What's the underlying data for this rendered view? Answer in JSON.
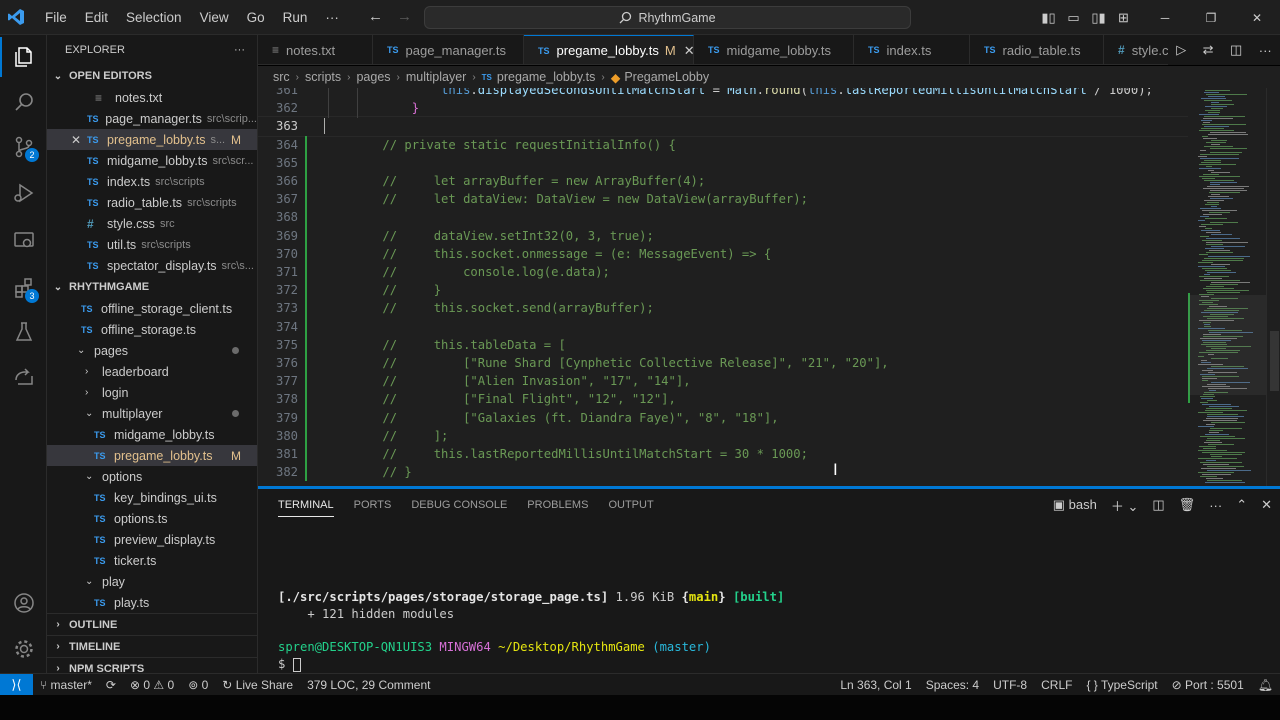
{
  "titlebar": {
    "menu": [
      "File",
      "Edit",
      "Selection",
      "View",
      "Go",
      "Run",
      "···"
    ],
    "search": "RhythmGame"
  },
  "activity": {
    "scm_badge": "2",
    "ext_badge": "3"
  },
  "sidebar": {
    "title": "EXPLORER",
    "open_editors_title": "OPEN EDITORS",
    "open_editors": [
      {
        "icon": "txt",
        "name": "notes.txt",
        "path": ""
      },
      {
        "icon": "TS",
        "name": "page_manager.ts",
        "path": "src\\scrip..."
      },
      {
        "icon": "TS",
        "name": "pregame_lobby.ts",
        "path": "s...",
        "status": "M"
      },
      {
        "icon": "TS",
        "name": "midgame_lobby.ts",
        "path": "src\\scr..."
      },
      {
        "icon": "TS",
        "name": "index.ts",
        "path": "src\\scripts"
      },
      {
        "icon": "TS",
        "name": "radio_table.ts",
        "path": "src\\scripts"
      },
      {
        "icon": "#",
        "name": "style.css",
        "path": "src"
      },
      {
        "icon": "TS",
        "name": "util.ts",
        "path": "src\\scripts"
      },
      {
        "icon": "TS",
        "name": "spectator_display.ts",
        "path": "src\\s..."
      }
    ],
    "project_title": "RHYTHMGAME",
    "tree": [
      {
        "icon": "TS",
        "name": "offline_storage_client.ts"
      },
      {
        "icon": "TS",
        "name": "offline_storage.ts"
      },
      {
        "folder": true,
        "open": true,
        "name": "pages"
      },
      {
        "folder": true,
        "open": false,
        "name": "leaderboard"
      },
      {
        "folder": true,
        "open": false,
        "name": "login"
      },
      {
        "folder": true,
        "open": true,
        "name": "multiplayer"
      },
      {
        "icon": "TS",
        "name": "midgame_lobby.ts"
      },
      {
        "icon": "TS",
        "name": "pregame_lobby.ts",
        "status": "M"
      },
      {
        "folder": true,
        "open": true,
        "name": "options"
      },
      {
        "icon": "TS",
        "name": "key_bindings_ui.ts"
      },
      {
        "icon": "TS",
        "name": "options.ts"
      },
      {
        "icon": "TS",
        "name": "preview_display.ts"
      },
      {
        "icon": "TS",
        "name": "ticker.ts"
      },
      {
        "folder": true,
        "open": true,
        "name": "play"
      },
      {
        "icon": "TS",
        "name": "play.ts"
      }
    ],
    "outline": "OUTLINE",
    "timeline": "TIMELINE",
    "npm": "NPM SCRIPTS"
  },
  "tabs": [
    {
      "icon": "txt",
      "name": "notes.txt"
    },
    {
      "icon": "TS",
      "name": "page_manager.ts"
    },
    {
      "icon": "TS",
      "name": "pregame_lobby.ts",
      "status": "M",
      "active": true
    },
    {
      "icon": "TS",
      "name": "midgame_lobby.ts"
    },
    {
      "icon": "TS",
      "name": "index.ts"
    },
    {
      "icon": "TS",
      "name": "radio_table.ts"
    },
    {
      "icon": "#",
      "name": "style.cs"
    }
  ],
  "breadcrumb": {
    "parts": [
      "src",
      "scripts",
      "pages",
      "multiplayer"
    ],
    "file": "pregame_lobby.ts",
    "symbol": "PregameLobby"
  },
  "editor": {
    "lines": [
      {
        "n": "361",
        "text": "            this.displayedSecondsUntilMatchStart = Math.round(this.lastReportedMillisUntilMatchStart / 1000);"
      },
      {
        "n": "362",
        "text": "        }"
      },
      {
        "n": "363",
        "text": ""
      },
      {
        "n": "364",
        "text": "    // private static requestInitialInfo() {"
      },
      {
        "n": "365",
        "text": ""
      },
      {
        "n": "366",
        "text": "    //     let arrayBuffer = new ArrayBuffer(4);"
      },
      {
        "n": "367",
        "text": "    //     let dataView: DataView = new DataView(arrayBuffer);"
      },
      {
        "n": "368",
        "text": ""
      },
      {
        "n": "369",
        "text": "    //     dataView.setInt32(0, 3, true);"
      },
      {
        "n": "370",
        "text": "    //     this.socket.onmessage = (e: MessageEvent) => {"
      },
      {
        "n": "371",
        "text": "    //         console.log(e.data);"
      },
      {
        "n": "372",
        "text": "    //     }"
      },
      {
        "n": "373",
        "text": "    //     this.socket.send(arrayBuffer);"
      },
      {
        "n": "374",
        "text": ""
      },
      {
        "n": "375",
        "text": "    //     this.tableData = ["
      },
      {
        "n": "376",
        "text": "    //         [\"Rune Shard [Cynphetic Collective Release]\", \"21\", \"20\"],"
      },
      {
        "n": "377",
        "text": "    //         [\"Alien Invasion\", \"17\", \"14\"],"
      },
      {
        "n": "378",
        "text": "    //         [\"Final Flight\", \"12\", \"12\"],"
      },
      {
        "n": "379",
        "text": "    //         [\"Galaxies (ft. Diandra Faye)\", \"8\", \"18\"],"
      },
      {
        "n": "380",
        "text": "    //     ];"
      },
      {
        "n": "381",
        "text": "    //     this.lastReportedMillisUntilMatchStart = 30 * 1000;"
      },
      {
        "n": "382",
        "text": "    // }"
      }
    ],
    "current_line": "363"
  },
  "panel": {
    "tabs": [
      "TERMINAL",
      "PORTS",
      "DEBUG CONSOLE",
      "PROBLEMS",
      "OUTPUT"
    ],
    "shell": "bash",
    "terminal": {
      "build_path": "[./src/scripts/pages/storage/storage_page.ts]",
      "build_size": " 1.96 KiB ",
      "build_chunk_open": "{",
      "build_chunk": "main",
      "build_chunk_close": "}",
      "build_status": " [built]",
      "hidden": "    + 121 hidden modules",
      "user_host": "spren@DESKTOP-QN1UIS3",
      "mingw": " MINGW64 ",
      "cwd": "~/Desktop/RhythmGame",
      "branch": " (master)",
      "prompt": "$"
    }
  },
  "statusbar": {
    "branch": "master*",
    "errors": "0",
    "warnings": "0",
    "ports": "0",
    "liveshare": "Live Share",
    "loc": "379 LOC, 29 Comment",
    "position": "Ln 363, Col 1",
    "spaces": "Spaces: 4",
    "encoding": "UTF-8",
    "eol": "CRLF",
    "language": "TypeScript",
    "port": "Port : 5501"
  }
}
